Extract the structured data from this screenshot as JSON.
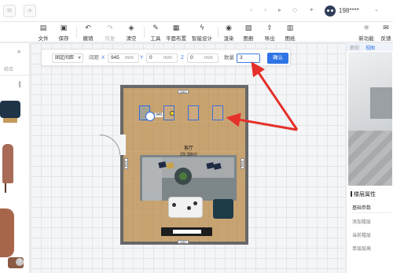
{
  "topbar": {
    "tabs": [
      "≡",
      "+"
    ],
    "right_icons": [
      "‹",
      "›",
      "▸",
      "◇",
      "✦",
      "○"
    ],
    "username": "198****",
    "caret": "⌄"
  },
  "toolbar": {
    "items": [
      {
        "label": "文件",
        "icon": "▤"
      },
      {
        "label": "保存",
        "icon": "▣"
      },
      {
        "label": "撤销",
        "icon": "↶"
      },
      {
        "label": "恢复",
        "icon": "↷"
      },
      {
        "label": "清空",
        "icon": "◈"
      },
      {
        "label": "工具",
        "icon": "✎"
      },
      {
        "label": "平面布置",
        "icon": "▦"
      },
      {
        "label": "智能设计",
        "icon": "ϟ"
      },
      {
        "label": "渲染",
        "icon": "◉"
      },
      {
        "label": "图册",
        "icon": "▧"
      },
      {
        "label": "导出",
        "icon": "⇪"
      },
      {
        "label": "图纸",
        "icon": "▥"
      },
      {
        "label": "新功能",
        "icon": "☼"
      },
      {
        "label": "反馈",
        "icon": "✉"
      }
    ]
  },
  "leftpanel": {
    "search_icon": "⌕",
    "sort_label": "综合",
    "filter_icon": "⫿"
  },
  "copybar": {
    "mode_label": "固定间距",
    "spacing_label": "间距",
    "x_axis": "X",
    "x_value": "945",
    "y_axis": "Y",
    "y_value": "0",
    "z_axis": "Z",
    "z_value": "0",
    "unit": "mm",
    "count_label": "数量",
    "count_value": "3",
    "confirm_label": "确认"
  },
  "room": {
    "name": "客厅",
    "area": "29.38m²",
    "dim_top": "4361",
    "dim_bottom": "4361",
    "dim_left": "5581",
    "dim_right": "5581",
    "selected_tag": "945"
  },
  "rightpanel": {
    "tabs": [
      "俯视",
      "视图"
    ],
    "section_title": "楼层属性",
    "items": [
      "基础参数",
      "添加楼层",
      "当前楼层",
      "单层层高"
    ]
  },
  "help_label": "?",
  "colors": {
    "accent": "#2f74e6",
    "arrow": "#e5312b",
    "floor": "#c8a372",
    "wall": "#686868"
  }
}
